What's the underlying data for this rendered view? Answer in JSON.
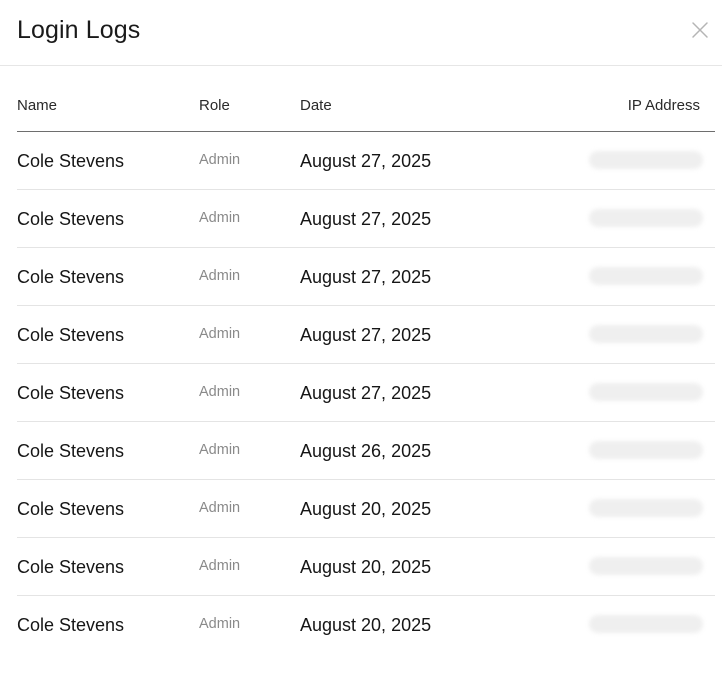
{
  "modal": {
    "title": "Login Logs",
    "close_icon": "close-icon"
  },
  "table": {
    "columns": {
      "name": "Name",
      "role": "Role",
      "date": "Date",
      "ip": "IP Address"
    },
    "rows": [
      {
        "name": "Cole Stevens",
        "role": "Admin",
        "date": "August 27, 2025"
      },
      {
        "name": "Cole Stevens",
        "role": "Admin",
        "date": "August 27, 2025"
      },
      {
        "name": "Cole Stevens",
        "role": "Admin",
        "date": "August 27, 2025"
      },
      {
        "name": "Cole Stevens",
        "role": "Admin",
        "date": "August 27, 2025"
      },
      {
        "name": "Cole Stevens",
        "role": "Admin",
        "date": "August 27, 2025"
      },
      {
        "name": "Cole Stevens",
        "role": "Admin",
        "date": "August 26, 2025"
      },
      {
        "name": "Cole Stevens",
        "role": "Admin",
        "date": "August 20, 2025"
      },
      {
        "name": "Cole Stevens",
        "role": "Admin",
        "date": "August 20, 2025"
      },
      {
        "name": "Cole Stevens",
        "role": "Admin",
        "date": "August 20, 2025"
      }
    ]
  },
  "colors": {
    "header_divider": "#e6e6e6",
    "table_header_border": "#6e6e6e",
    "row_border": "#e4e4e4",
    "role_text": "#8a8a8a"
  }
}
